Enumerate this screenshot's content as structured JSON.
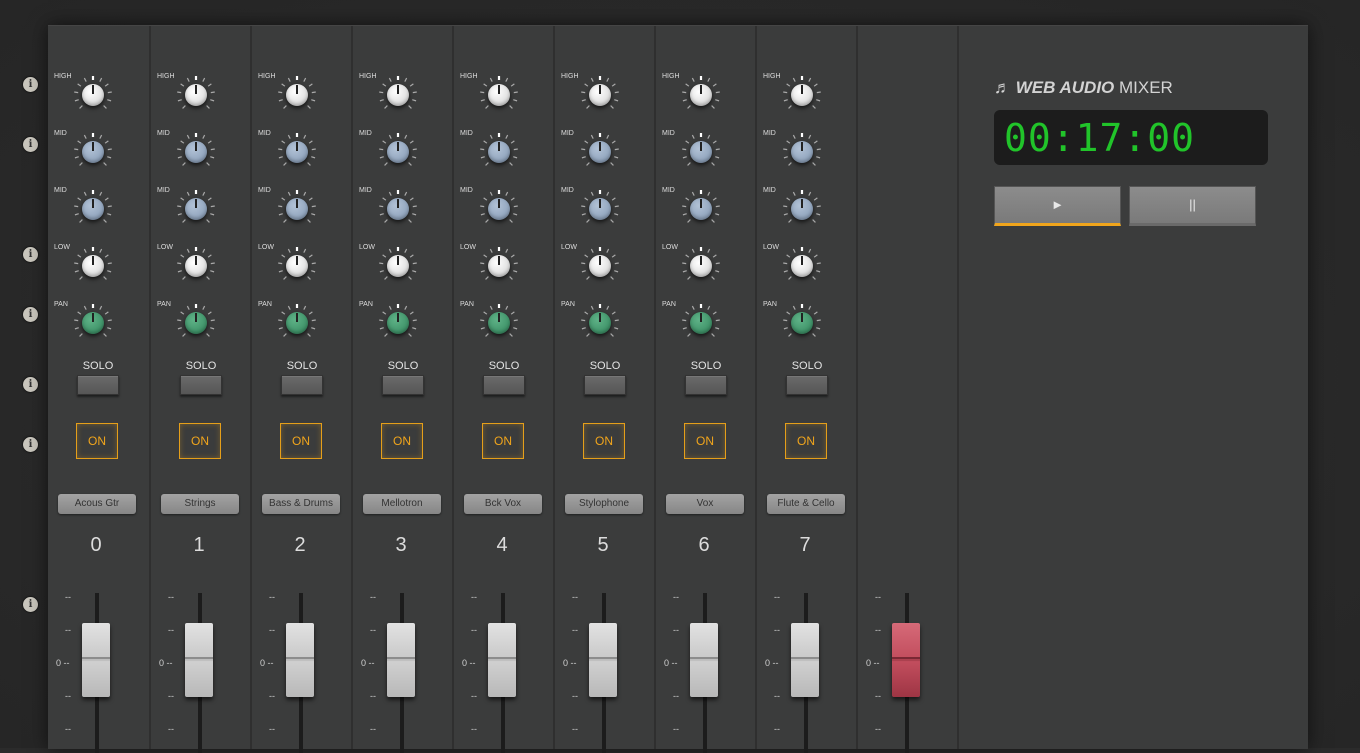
{
  "app": {
    "title_bold": "WEB AUDIO",
    "title_rest": "MIXER",
    "title_icon": "music-note-icon"
  },
  "transport": {
    "time": "00:17:00",
    "play_label": "►",
    "pause_label": "||"
  },
  "info_icon_glyph": "i",
  "knob_labels": [
    "HIGH",
    "MID",
    "MID",
    "LOW",
    "PAN"
  ],
  "solo_label": "SOLO",
  "on_label": "ON",
  "fader_scale": [
    "--",
    "--",
    "0 --",
    "--",
    "--"
  ],
  "channels": [
    {
      "number": "0",
      "name": "Acous Gtr"
    },
    {
      "number": "1",
      "name": "Strings"
    },
    {
      "number": "2",
      "name": "Bass & Drums"
    },
    {
      "number": "3",
      "name": "Mellotron"
    },
    {
      "number": "4",
      "name": "Bck Vox"
    },
    {
      "number": "5",
      "name": "Stylophone"
    },
    {
      "number": "6",
      "name": "Vox"
    },
    {
      "number": "7",
      "name": "Flute & Cello"
    }
  ],
  "master": {
    "fader_scale": [
      "--",
      "--",
      "0 --",
      "--",
      "--"
    ]
  },
  "colors": {
    "accent": "#f0a51c",
    "display_digits": "#21c42a",
    "master_fader": "#c24e5e"
  }
}
